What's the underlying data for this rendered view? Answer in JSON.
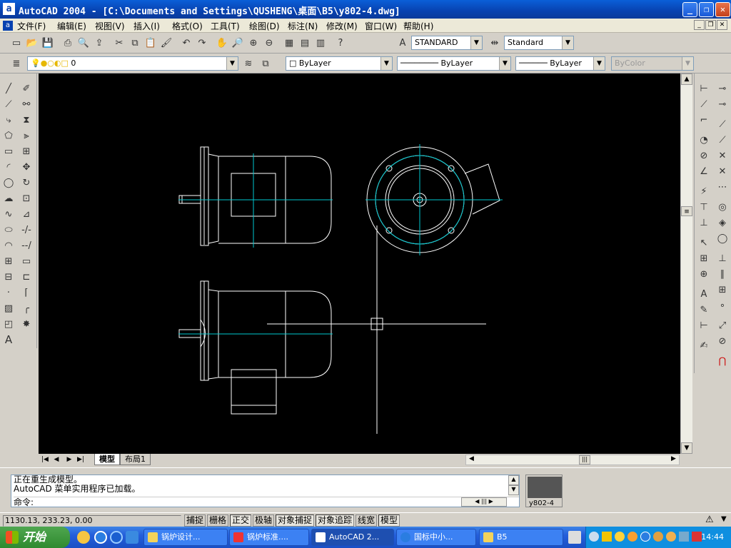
{
  "window": {
    "title": "AutoCAD 2004 - [C:\\Documents and Settings\\QUSHENG\\桌面\\B5\\y802-4.dwg]",
    "controls": {
      "minimize": "_",
      "restore": "❐",
      "close": "✕"
    }
  },
  "menubar": {
    "items": [
      "文件(F)",
      "编辑(E)",
      "视图(V)",
      "插入(I)",
      "格式(O)",
      "工具(T)",
      "绘图(D)",
      "标注(N)",
      "修改(M)",
      "窗口(W)",
      "帮助(H)"
    ]
  },
  "toolbar_standard": {
    "text_style": "STANDARD",
    "dim_style": "Standard"
  },
  "toolbar_layers": {
    "layer": "0",
    "color": "ByLayer",
    "linetype": "ByLayer",
    "lineweight": "ByLayer",
    "plotstyle": "ByColor"
  },
  "layout_tabs": [
    "模型",
    "布局1"
  ],
  "command_window": {
    "lines": [
      "正在重生成模型。",
      "AutoCAD 菜单实用程序已加载。"
    ],
    "prompt": "命令:"
  },
  "thumbnail": {
    "label": "y802-4"
  },
  "status_bar": {
    "coords": "1130.13, 233.23, 0.00",
    "toggles": [
      {
        "label": "捕捉",
        "on": false
      },
      {
        "label": "栅格",
        "on": false
      },
      {
        "label": "正交",
        "on": true
      },
      {
        "label": "极轴",
        "on": false
      },
      {
        "label": "对象捕捉",
        "on": true
      },
      {
        "label": "对象追踪",
        "on": true
      },
      {
        "label": "线宽",
        "on": false
      },
      {
        "label": "模型",
        "on": true
      }
    ]
  },
  "taskbar": {
    "start": "开始",
    "tasks": [
      "锅炉设计...",
      "锅炉标准....",
      "AutoCAD 2...",
      "国标中小...",
      "B5"
    ],
    "clock": "14:44"
  },
  "colors": {
    "canvas": "#000000",
    "drawing_lines": "#ffffff",
    "center_lines": "#00c8d0",
    "titlebar": "#0842b0"
  }
}
